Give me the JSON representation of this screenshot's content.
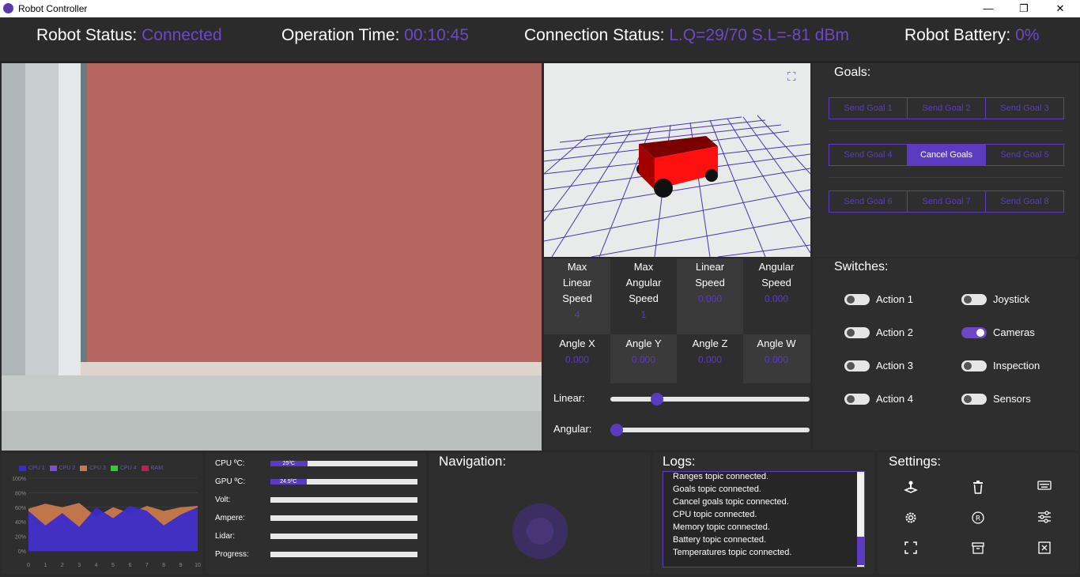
{
  "window": {
    "title": "Robot Controller",
    "minimize": "—",
    "maximize": "❐",
    "close": "✕"
  },
  "status": {
    "robot_label": "Robot Status:",
    "robot_value": "Connected",
    "time_label": "Operation Time:",
    "time_value": "00:10:45",
    "conn_label": "Connection Status:",
    "conn_value": "L.Q=29/70 S.L=-81 dBm",
    "battery_label": "Robot Battery:",
    "battery_value": "0%"
  },
  "goals": {
    "title": "Goals:",
    "rows": [
      [
        "Send Goal 1",
        "Send Goal 2",
        "Send Goal 3"
      ],
      [
        "Send Goal 4",
        "Cancel Goals",
        "Send Goal 5"
      ],
      [
        "Send Goal 6",
        "Send Goal 7",
        "Send Goal 8"
      ]
    ]
  },
  "metrics": {
    "max_linear": {
      "label_1": "Max",
      "label_2": "Linear",
      "label_3": "Speed",
      "value": "4"
    },
    "max_angular": {
      "label_1": "Max",
      "label_2": "Angular",
      "label_3": "Speed",
      "value": "1"
    },
    "linear_speed": {
      "label_1": "Linear",
      "label_2": "Speed",
      "value": "0.000"
    },
    "angular_speed": {
      "label_1": "Angular",
      "label_2": "Speed",
      "value": "0.000"
    },
    "angle_x": {
      "label": "Angle X",
      "value": "0.000"
    },
    "angle_y": {
      "label": "Angle Y",
      "value": "0.000"
    },
    "angle_z": {
      "label": "Angle Z",
      "value": "0.000"
    },
    "angle_w": {
      "label": "Angle W",
      "value": "0.000"
    }
  },
  "sliders": {
    "linear_label": "Linear:",
    "angular_label": "Angular:",
    "linear_value": 0.06,
    "angular_value": 0.0
  },
  "switches": {
    "title": "Switches:",
    "items": [
      {
        "label": "Action 1",
        "on": false
      },
      {
        "label": "Joystick",
        "on": false
      },
      {
        "label": "Action 2",
        "on": false
      },
      {
        "label": "Cameras",
        "on": true
      },
      {
        "label": "Action 3",
        "on": false
      },
      {
        "label": "Inspection",
        "on": false
      },
      {
        "label": "Action 4",
        "on": false
      },
      {
        "label": "Sensors",
        "on": false
      }
    ]
  },
  "chart_data": {
    "type": "area",
    "legend": [
      "CPU 1",
      "CPU 2",
      "CPU 3",
      "CPU 4",
      "RAM"
    ],
    "colors": {
      "cpu1": "#3a2cc8",
      "cpu2": "#7a4fd8",
      "cpu3": "#c87a4a",
      "cpu4": "#33cc33",
      "ram": "#c81a5a"
    },
    "x_ticks": [
      "0",
      "1",
      "2",
      "3",
      "4",
      "5",
      "6",
      "7",
      "8",
      "9",
      "10"
    ],
    "y_ticks": [
      "100%",
      "80%",
      "60%",
      "40%",
      "20%",
      "0%"
    ],
    "x": [
      0,
      1,
      2,
      3,
      4,
      5,
      6,
      7,
      8,
      9,
      10
    ],
    "series": [
      {
        "name": "CPU 3",
        "values": [
          58,
          65,
          60,
          66,
          47,
          60,
          52,
          62,
          55,
          60,
          62
        ]
      },
      {
        "name": "CPU 1",
        "values": [
          55,
          35,
          52,
          33,
          60,
          45,
          62,
          55,
          35,
          50,
          60
        ]
      }
    ],
    "ylim": [
      0,
      100
    ],
    "xlim": [
      0,
      10
    ]
  },
  "info": {
    "cpu_label": "CPU ºC:",
    "cpu_value": "25ºC",
    "cpu_fill": 0.25,
    "gpu_label": "GPU ºC:",
    "gpu_value": "24.5ºC",
    "gpu_fill": 0.245,
    "volt_label": "Volt:",
    "amp_label": "Ampere:",
    "lidar_label": "Lidar:",
    "progress_label": "Progress:"
  },
  "navigation": {
    "title": "Navigation:"
  },
  "logs": {
    "title": "Logs:",
    "lines": [
      "Ranges topic connected.",
      "Goals topic connected.",
      "Cancel goals topic connected.",
      "CPU topic connected.",
      "Memory topic connected.",
      "Battery topic connected.",
      "Temperatures topic connected."
    ]
  },
  "settings": {
    "title": "Settings:"
  },
  "icons": {
    "expand": "expand-icon",
    "joystick": "joystick-icon",
    "trash": "trash-icon",
    "keyboard": "keyboard-icon",
    "gear": "gear-icon",
    "ros": "ros-icon",
    "sliders": "sliders-icon",
    "fullscreen": "fullscreen-icon",
    "archive": "archive-icon",
    "close-box": "close-box-icon"
  },
  "accent": "#5b3cc0"
}
